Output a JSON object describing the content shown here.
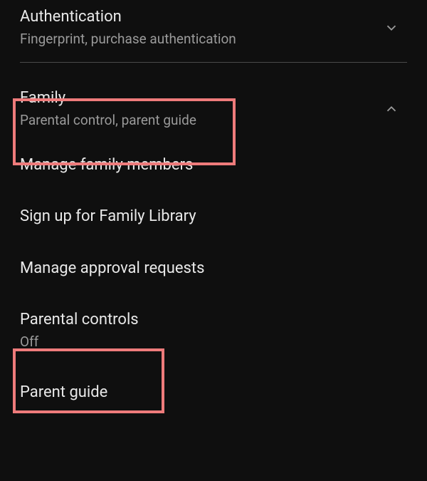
{
  "sections": {
    "authentication": {
      "title": "Authentication",
      "subtitle": "Fingerprint, purchase authentication"
    },
    "family": {
      "title": "Family",
      "subtitle": "Parental control, parent guide",
      "items": [
        {
          "title": "Manage family members"
        },
        {
          "title": "Sign up for Family Library"
        },
        {
          "title": "Manage approval requests"
        },
        {
          "title": "Parental controls",
          "subtitle": "Off"
        },
        {
          "title": "Parent guide"
        }
      ]
    }
  }
}
